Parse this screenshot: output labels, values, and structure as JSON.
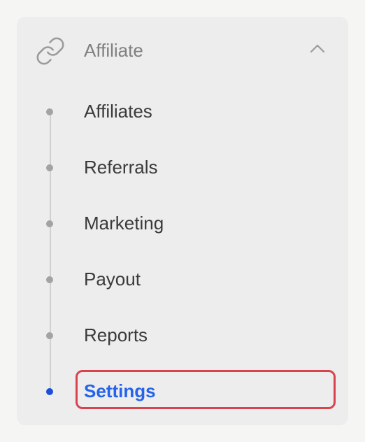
{
  "section": {
    "title": "Affiliate",
    "icon": "link-icon",
    "toggle_icon": "chevron-up-icon",
    "expanded": true
  },
  "nav": {
    "items": [
      {
        "label": "Affiliates",
        "active": false
      },
      {
        "label": "Referrals",
        "active": false
      },
      {
        "label": "Marketing",
        "active": false
      },
      {
        "label": "Payout",
        "active": false
      },
      {
        "label": "Reports",
        "active": false
      },
      {
        "label": "Settings",
        "active": true
      }
    ]
  },
  "colors": {
    "active": "#2563eb",
    "highlight_border": "#d9434d",
    "panel_bg": "#ededed"
  }
}
